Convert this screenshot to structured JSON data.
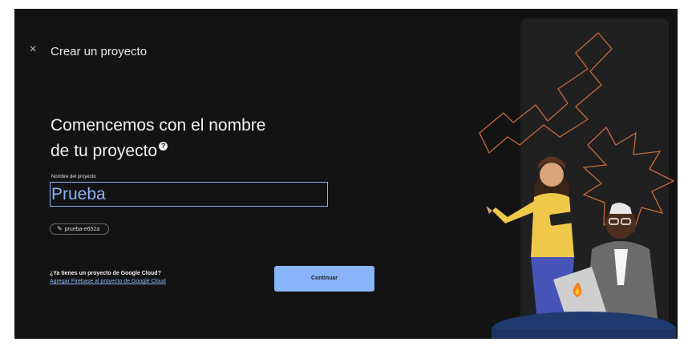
{
  "header": {
    "close_glyph": "×",
    "title": "Crear un proyecto"
  },
  "main": {
    "heading_line1": "Comencemos con el nombre",
    "heading_line2": "de tu proyecto",
    "help_glyph": "?",
    "project_name_label": "Nombre del proyecto",
    "project_name_value": "Prueba",
    "project_id": "prueba-e652a",
    "google_cloud_question": "¿Ya tienes un proyecto de Google Cloud?",
    "google_cloud_link": "Agregar Firebase al proyecto de Google Cloud",
    "continue_label": "Continuar"
  },
  "icons": {
    "close": "close-icon",
    "help": "help-icon",
    "edit": "pencil-icon"
  },
  "colors": {
    "background": "#131313",
    "accent": "#8ab4f8",
    "text": "#f1f1f1",
    "illustration_line": "#c86a3a"
  }
}
